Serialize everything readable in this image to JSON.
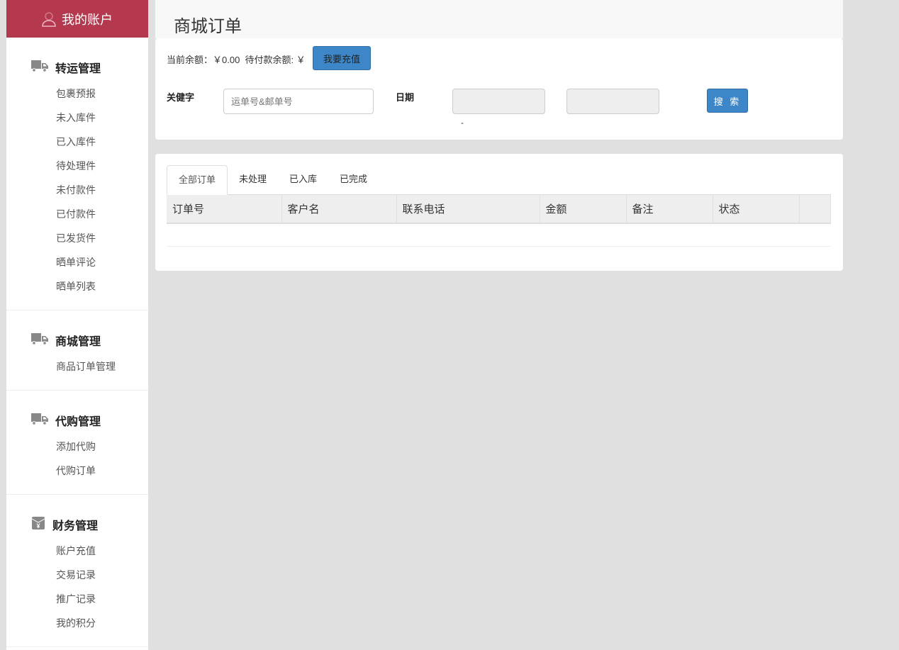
{
  "sidebar": {
    "account": "我的账户",
    "sections": [
      {
        "title": "转运管理",
        "icon": "truck-icon",
        "items": [
          "包裹预报",
          "未入库件",
          "已入库件",
          "待处理件",
          "未付款件",
          "已付款件",
          "已发货件",
          "晒单评论",
          "晒单列表"
        ]
      },
      {
        "title": "商城管理",
        "icon": "truck-icon",
        "items": [
          "商品订单管理"
        ]
      },
      {
        "title": "代购管理",
        "icon": "truck-icon",
        "items": [
          "添加代购",
          "代购订单"
        ]
      },
      {
        "title": "财务管理",
        "icon": "yen-wallet-icon",
        "items": [
          "账户充值",
          "交易记录",
          "推广记录",
          "我的积分"
        ]
      }
    ]
  },
  "page_title": "商城订单",
  "balance": {
    "text": "当前余额：￥0.00  待付款余额: ￥",
    "recharge": "我要充值"
  },
  "filter": {
    "keyword_label": "关健字",
    "keyword_placeholder": "运单号&邮单号",
    "date_label": "日期",
    "dash": "-",
    "search": "搜 索"
  },
  "tabs": [
    "全部订单",
    "未处理",
    "已入库",
    "已完成"
  ],
  "table": {
    "columns": [
      "订单号",
      "客户名",
      "联系电话",
      "金额",
      "备注",
      "状态",
      ""
    ]
  }
}
